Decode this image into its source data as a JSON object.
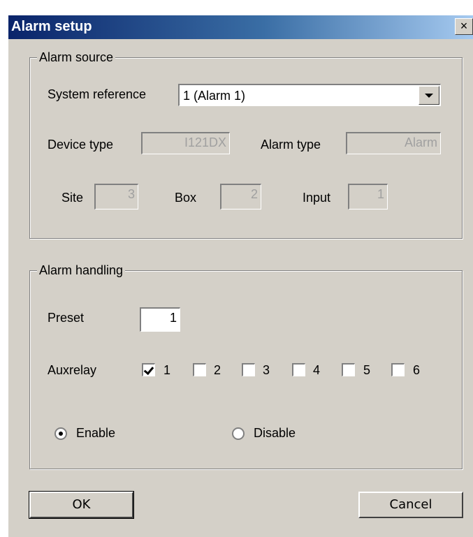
{
  "window": {
    "title": "Alarm setup",
    "close_glyph": "×"
  },
  "alarm_source": {
    "group_label": "Alarm source",
    "system_reference_label": "System reference",
    "system_reference_value": "1 (Alarm 1)",
    "device_type_label": "Device type",
    "device_type_value": "I121DX",
    "alarm_type_label": "Alarm type",
    "alarm_type_value": "Alarm",
    "site_label": "Site",
    "site_value": "3",
    "box_label": "Box",
    "box_value": "2",
    "input_label": "Input",
    "input_value": "1"
  },
  "alarm_handling": {
    "group_label": "Alarm handling",
    "preset_label": "Preset",
    "preset_value": "1",
    "auxrelay_label": "Auxrelay",
    "auxrelays": [
      {
        "label": "1",
        "checked": true
      },
      {
        "label": "2",
        "checked": false
      },
      {
        "label": "3",
        "checked": false
      },
      {
        "label": "4",
        "checked": false
      },
      {
        "label": "5",
        "checked": false
      },
      {
        "label": "6",
        "checked": false
      }
    ],
    "enable_label": "Enable",
    "disable_label": "Disable",
    "selected_mode": "Enable"
  },
  "buttons": {
    "ok_label": "OK",
    "cancel_label": "Cancel"
  },
  "icons": {
    "close": "close-icon",
    "dropdown": "chevron-down-icon",
    "check": "checkmark-icon"
  }
}
